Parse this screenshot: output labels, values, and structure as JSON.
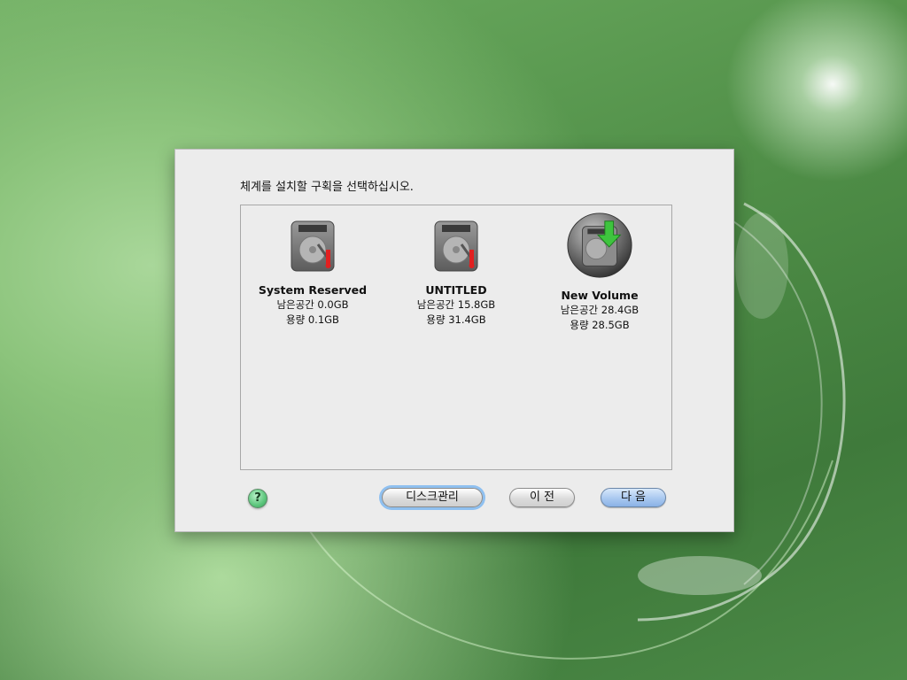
{
  "dialog": {
    "prompt": "체계를 설치할 구획을 선택하십시오.",
    "volumes": [
      {
        "name": "System Reserved",
        "free": "남은공간 0.0GB",
        "capacity": "용량 0.1GB",
        "icon": "hard-drive-icon",
        "selected": false
      },
      {
        "name": "UNTITLED",
        "free": "남은공간 15.8GB",
        "capacity": "용량 31.4GB",
        "icon": "hard-drive-icon",
        "selected": false
      },
      {
        "name": "New Volume",
        "free": "남은공간 28.4GB",
        "capacity": "용량 28.5GB",
        "icon": "hard-drive-install-icon",
        "selected": true
      }
    ],
    "help_label": "?",
    "buttons": {
      "disk_management": "디스크관리",
      "back": "이 전",
      "next": "다 음"
    }
  },
  "colors": {
    "background": "#5f9e57",
    "dialog": "#ececec",
    "default_button": "#a9c8f0",
    "install_arrow": "#3ec43e"
  }
}
